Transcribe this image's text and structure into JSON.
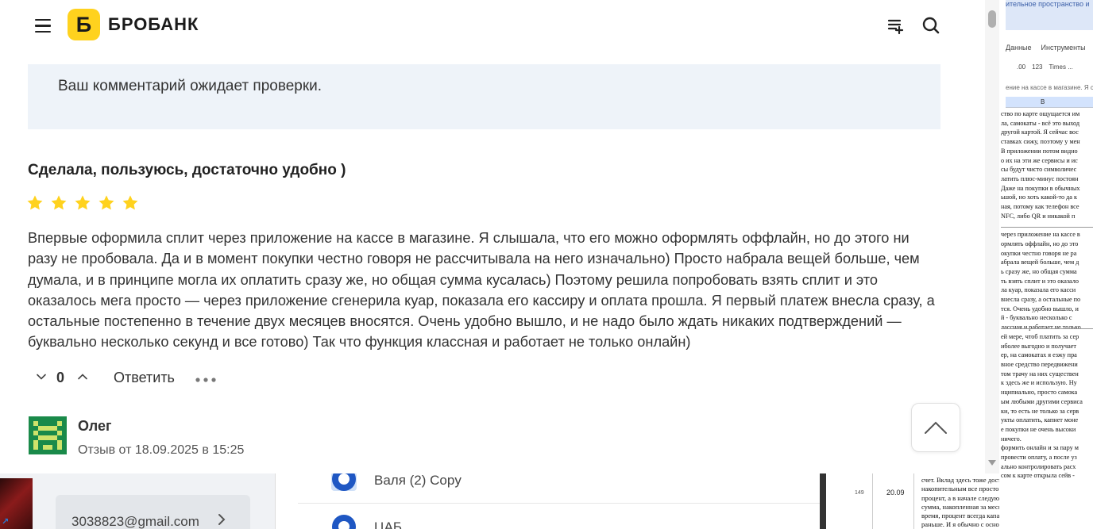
{
  "header": {
    "logo_letter": "Б",
    "logo_text": "БРОБАНК"
  },
  "notice": {
    "text": "Ваш комментарий ожидает проверки."
  },
  "review": {
    "title": "Сделала, пользуюсь, достаточно удобно )",
    "rating": 5,
    "text": "Впервые оформила сплит через приложение на кассе в магазине. Я слышала, что его можно оформлять оффлайн, но до этого ни разу не пробовала. Да и в момент покупки честно говоря не рассчитывала на него изначально) Просто набрала вещей больше, чем думала, и в принципе могла их оплатить сразу же, но общая сумма кусалась) Поэтому решила попробовать взять сплит и это оказалось мега просто — через приложение сгенерила куар, показала его кассиру и оплата прошла. Я первый платеж внесла сразу, а остальные постепенно в течение двух месяцев вносятся. Очень удобно вышло, и не надо было ждать никаких подтверждений — буквально несколько секунд и все готово) Так что функция классная и работает не только онлайн)",
    "vote_count": "0",
    "reply_label": "Ответить"
  },
  "next_review": {
    "author": "Олег",
    "date": "Отзыв от 18.09.2025 в 15:25"
  },
  "colors": {
    "brand_yellow": "#ffd21e",
    "star_yellow": "#ffd21e",
    "notice_bg": "#eef3f9",
    "avatar_green": "#1a8a4a"
  },
  "sheet": {
    "banner": "ительное пространство и",
    "menu": [
      "Данные",
      "Инструменты"
    ],
    "tools": [
      ".00",
      "123",
      "Times ..."
    ],
    "formula": "ение на кассе в магазине. Я сл",
    "column": "B",
    "lines": [
      "ство по карте ощущается им",
      "ла, самокаты - всё это выход",
      "другой картой. Я сейчас вос",
      "ставках сижу, поэтому у мен",
      "В приложении потом видно",
      "о их на эти же сервисы и ис",
      "сы будут чисто символичес",
      "латить плюс-минус постоян",
      "Даже на покупки в обычных",
      "ьшой, но хоть какой-то да к",
      "ная, потому как телефон все",
      " NFC, либо QR и никакой п",
      "",
      "через приложение на кассе в",
      "ормлять оффлайн, но до это",
      "окупки честно говоря не ра",
      "абрала вещей больше, чем д",
      "ь сразу же, но общая сумма",
      "ть взять сплит и это оказало",
      "ла куар, показала его касси",
      "внесла сразу, а остальные по",
      "тся. Очень удобно вышло, и",
      "й - буквально несколько с",
      "лассная и работает не только",
      "ей мере, чтоб платить за сер",
      "иболее выгодно и получает",
      "ер, на самокатах я езжу пра",
      "вное средство передвижени",
      "том трачу на них существен",
      "к здесь же и использую. Ну",
      "нципиально, просто самока",
      "ым любыми другими сервиса",
      "ки, то есть не только за серв",
      "укты оплатить, капнет моне",
      "е покупки не очень высоки",
      "ничего.",
      "формить онлайн и за пару м",
      " провести оплату, а после уз",
      "ально контролировать расх",
      "сом к карте открыла сейв -"
    ]
  },
  "background": {
    "email": "3038823@gmail.com",
    "item1": "Валя (2) Copy",
    "item2": "ЦАБ",
    "row_number": "149",
    "cell_value": "20.09",
    "text_lines": [
      "счет. Вклад здесь тоже доступен, но его я не открывала",
      "накопительным все просто - пополняешь и каждый день",
      "процент, а в начале следующего расчетного периода на",
      "сумма, накопленная за месяц. Выводить можно спокойно",
      "время, процент всегда капает на остаток и не теряется",
      "раньше. И я обычно с основного счета перевожу на них"
    ]
  }
}
